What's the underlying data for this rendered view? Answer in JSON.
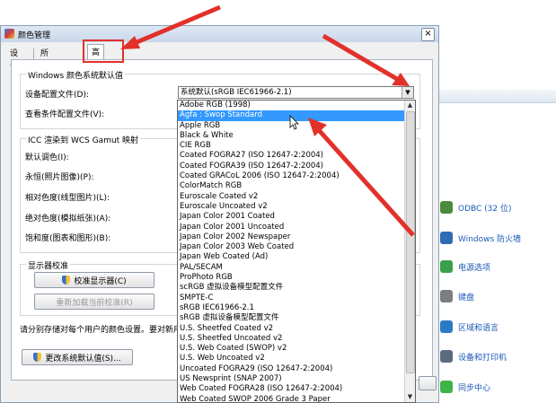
{
  "dialog": {
    "title": "颜色管理",
    "close_label": "×",
    "tabs": [
      "设备",
      "所有配置文件",
      "高级"
    ],
    "active_tab": "高级"
  },
  "windows_defaults": {
    "title": "Windows 颜色系统默认值",
    "device_profile_label": "设备配置文件(D):",
    "device_profile_value": "系统默认(sRGB IEC61966-2.1)",
    "viewing_conditions_label": "查看条件配置文件(V):"
  },
  "icc_mapping": {
    "title": "ICC 渲染到 WCS Gamut 映射",
    "labels": [
      "默认调色(I):",
      "永恒(照片图像)(P):",
      "相对色度(线型图片)(L):",
      "绝对色度(模拟纸张)(A):",
      "饱和度(图表和图形)(B):"
    ]
  },
  "display_calibration": {
    "title": "显示器校准",
    "calibrate_button": "校准显示器(C)",
    "reload_button": "重新加载当前校准(R)"
  },
  "note": "请分别存储对每个用户的颜色设置。要对新用户和",
  "change_defaults_button": "更改系统默认值(S)...",
  "dropdown": {
    "options": [
      "Adobe RGB (1998)",
      "Agfa : Swop Standard",
      "Apple RGB",
      "Black & White",
      "CIE RGB",
      "Coated FOGRA27 (ISO 12647-2:2004)",
      "Coated FOGRA39 (ISO 12647-2:2004)",
      "Coated GRACoL 2006 (ISO 12647-2:2004)",
      "ColorMatch RGB",
      "Euroscale Coated v2",
      "Euroscale Uncoated v2",
      "Japan Color 2001 Coated",
      "Japan Color 2001 Uncoated",
      "Japan Color 2002 Newspaper",
      "Japan Color 2003 Web Coated",
      "Japan Web Coated (Ad)",
      "PAL/SECAM",
      "ProPhoto RGB",
      "scRGB 虚拟设备模型配置文件",
      "SMPTE-C",
      "sRGB IEC61966-2.1",
      "sRGB 虚拟设备模型配置文件",
      "U.S. Sheetfed Coated v2",
      "U.S. Sheetfed Uncoated v2",
      "U.S. Web Coated (SWOP) v2",
      "U.S. Web Uncoated v2",
      "Uncoated FOGRA29 (ISO 12647-2:2004)",
      "US Newsprint (SNAP 2007)",
      "Web Coated FOGRA28 (ISO 12647-2:2004)",
      "Web Coated SWOP 2006 Grade 3 Paper"
    ],
    "highlighted": "Agfa : Swop Standard"
  },
  "background_panel": {
    "items": [
      {
        "label": "ODBC (32 位)",
        "icon": "odbc-icon",
        "color": "#4a8a3c"
      },
      {
        "label": "Windows 防火墙",
        "icon": "firewall-icon",
        "color": "#2d6db5"
      },
      {
        "label": "电源选项",
        "icon": "power-icon",
        "color": "#3aa04a"
      },
      {
        "label": "键盘",
        "icon": "keyboard-icon",
        "color": "#7d7d7d"
      },
      {
        "label": "区域和语言",
        "icon": "region-icon",
        "color": "#2b7bc4"
      },
      {
        "label": "设备和打印机",
        "icon": "printer-icon",
        "color": "#5a6b80"
      },
      {
        "label": "同步中心",
        "icon": "sync-icon",
        "color": "#3db34a"
      }
    ]
  },
  "colors": {
    "annotation_red": "#e2312a",
    "selection_blue": "#3399ff",
    "link_blue": "#1c58b8"
  }
}
